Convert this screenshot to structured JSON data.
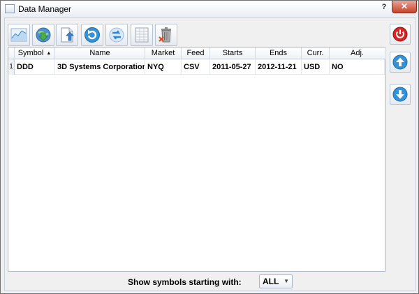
{
  "window": {
    "title": "Data Manager",
    "help_label": "?",
    "close_label": "✕"
  },
  "toolbar": {
    "buttons": [
      {
        "name": "chart-icon"
      },
      {
        "name": "globe-download-icon"
      },
      {
        "name": "export-file-icon"
      },
      {
        "name": "refresh-icon"
      },
      {
        "name": "convert-icon"
      },
      {
        "name": "spreadsheet-icon"
      },
      {
        "name": "delete-trash-icon"
      }
    ]
  },
  "side_buttons": [
    {
      "name": "power-icon"
    },
    {
      "name": "arrow-up-icon"
    },
    {
      "name": "arrow-down-icon"
    }
  ],
  "grid": {
    "columns": [
      "Symbol",
      "Name",
      "Market",
      "Feed",
      "Starts",
      "Ends",
      "Curr.",
      "Adj."
    ],
    "sort_indicator": "▲",
    "rows": [
      {
        "num": "1",
        "cells": [
          "DDD",
          "3D Systems Corporation",
          "NYQ",
          "CSV",
          "2011-05-27",
          "2012-11-21",
          "USD",
          "NO"
        ]
      }
    ]
  },
  "filter": {
    "label": "Show symbols starting with:",
    "value": "ALL"
  },
  "colors": {
    "accent_red": "#c41e1e",
    "accent_blue": "#2a8ad8",
    "frame": "#a9b5c6"
  }
}
